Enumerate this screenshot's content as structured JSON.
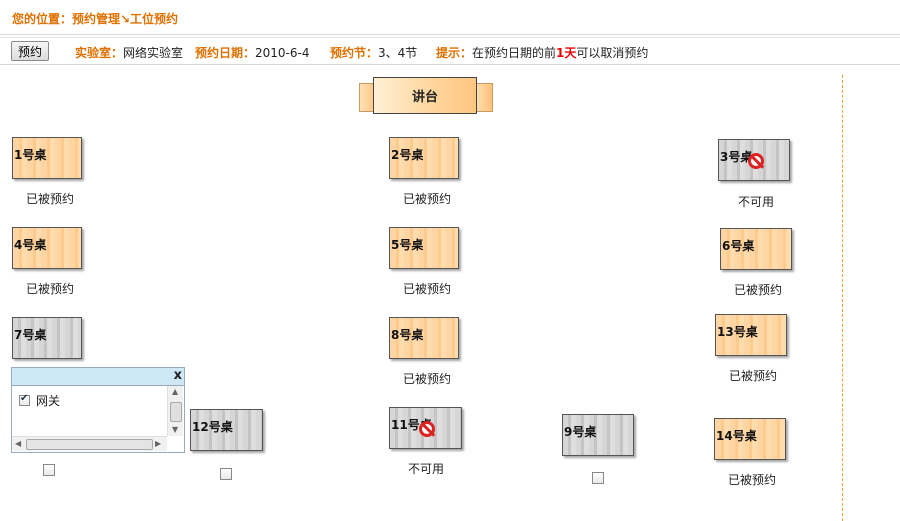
{
  "breadcrumb": {
    "text": "您的位置：预约管理↘工位预约"
  },
  "infobar": {
    "reserve_button": "预约",
    "lab_label": "实验室：",
    "lab_value": "网络实验室",
    "date_label": "预约日期：",
    "date_value": "2010-6-4",
    "period_label": "预约节：",
    "period_value": "3、4节",
    "tip_label": "提示：",
    "tip_prefix": "在预约日期的前",
    "tip_highlight": "1天",
    "tip_suffix": "可以取消预约"
  },
  "podium": {
    "label": "讲台"
  },
  "desks": [
    {
      "name": "1号桌",
      "status": "已被预约",
      "color": "orange"
    },
    {
      "name": "2号桌",
      "status": "已被预约",
      "color": "orange"
    },
    {
      "name": "3号桌",
      "status": "不可用",
      "color": "gray",
      "icon": "no-entry-icon"
    },
    {
      "name": "4号桌",
      "status": "已被预约",
      "color": "orange"
    },
    {
      "name": "5号桌",
      "status": "已被预约",
      "color": "orange"
    },
    {
      "name": "6号桌",
      "status": "已被预约",
      "color": "orange"
    },
    {
      "name": "7号桌",
      "status": "",
      "color": "gray"
    },
    {
      "name": "8号桌",
      "status": "已被预约",
      "color": "orange"
    },
    {
      "name": "13号桌",
      "status": "已被预约",
      "color": "orange"
    },
    {
      "name": "12号桌",
      "status": "",
      "color": "gray"
    },
    {
      "name": "11号桌",
      "status": "不可用",
      "color": "gray",
      "icon": "no-entry-icon"
    },
    {
      "name": "9号桌",
      "status": "",
      "color": "gray"
    },
    {
      "name": "14号桌",
      "status": "已被预约",
      "color": "orange"
    }
  ],
  "popup": {
    "close_label": "x",
    "item_label": "网关",
    "item_checked": true
  },
  "colors": {
    "accent": "#e07000",
    "highlight": "#ee0000",
    "reserved": "#ffd29a",
    "available": "#d2d2d2"
  }
}
